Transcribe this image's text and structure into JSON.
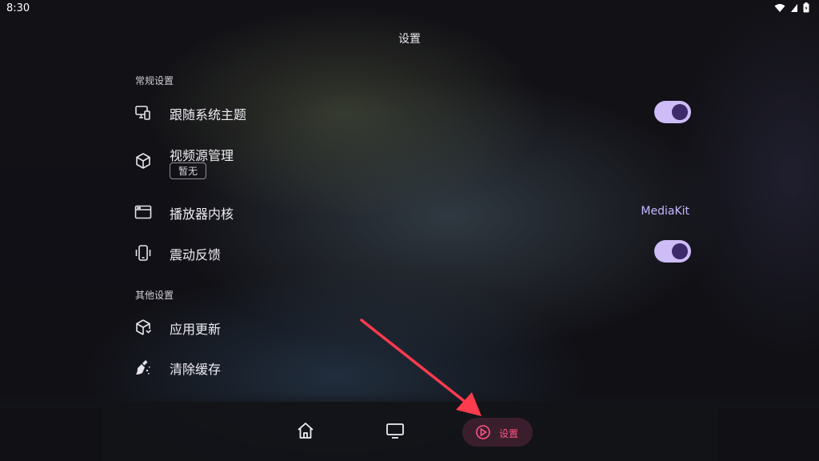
{
  "status_bar": {
    "time": "8:30"
  },
  "page_title": "设置",
  "sections": [
    {
      "header": "常规设置",
      "items": [
        {
          "label": "跟随系统主题",
          "icon": "monitor-phone-icon",
          "toggle": true
        },
        {
          "label": "视频源管理",
          "icon": "cube-icon",
          "badge": "暂无"
        },
        {
          "label": "播放器内核",
          "icon": "window-icon",
          "value": "MediaKit"
        },
        {
          "label": "震动反馈",
          "icon": "vibrate-phone-icon",
          "toggle": true
        }
      ]
    },
    {
      "header": "其他设置",
      "items": [
        {
          "label": "应用更新",
          "icon": "box-update-icon"
        },
        {
          "label": "清除缓存",
          "icon": "broom-icon"
        }
      ]
    }
  ],
  "bottom_nav": {
    "items": [
      {
        "icon": "home-icon"
      },
      {
        "icon": "tv-icon"
      },
      {
        "icon": "settings-icon",
        "label": "设置",
        "active": true
      }
    ]
  },
  "colors": {
    "accent": "#cdbcf6",
    "toggle_knob": "#3c2a6b",
    "value_text": "#c6b8ff",
    "nav_active_text": "#ff5585",
    "nav_active_bg": "#3a1e2c",
    "annotation_arrow": "#ff3b4e"
  }
}
